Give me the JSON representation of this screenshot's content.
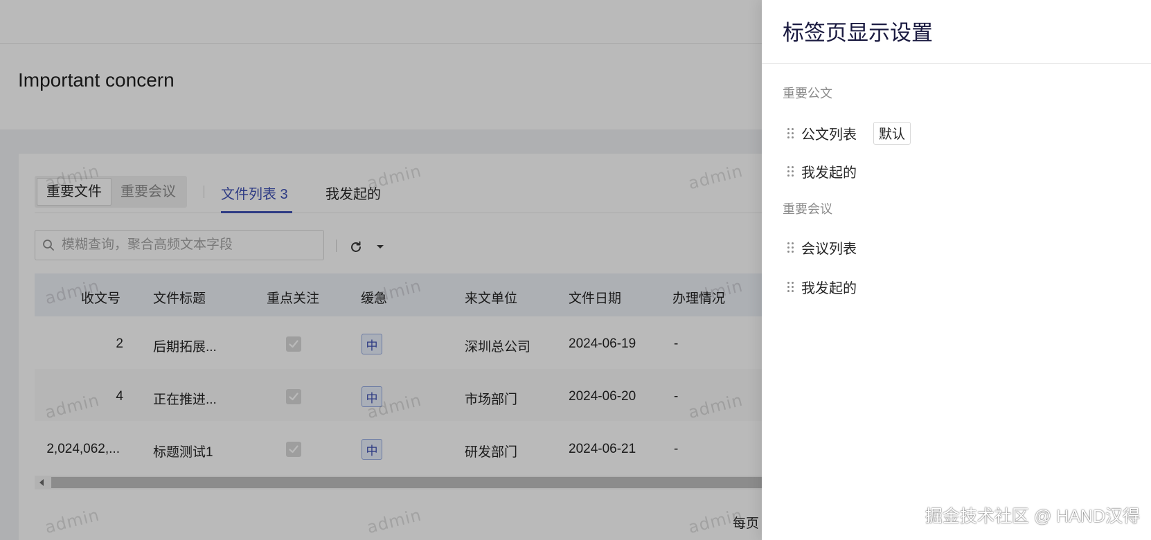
{
  "page": {
    "title": "Important concern"
  },
  "segmented": [
    {
      "label": "重要文件",
      "active": true
    },
    {
      "label": "重要会议",
      "active": false
    }
  ],
  "tabs": [
    {
      "label": "文件列表 3",
      "active": true
    },
    {
      "label": "我发起的",
      "active": false
    }
  ],
  "toolbar": {
    "search_placeholder": "模糊查询，聚合高频文本字段"
  },
  "table": {
    "columns": [
      "收文号",
      "文件标题",
      "重点关注",
      "缓急",
      "来文单位",
      "文件日期",
      "办理情况"
    ],
    "rows": [
      {
        "no": "2",
        "title": "后期拓展...",
        "focus": true,
        "urgency": "中",
        "unit": "深圳总公司",
        "date": "2024-06-19",
        "status": "-"
      },
      {
        "no": "4",
        "title": "正在推进...",
        "focus": true,
        "urgency": "中",
        "unit": "市场部门",
        "date": "2024-06-20",
        "status": "-"
      },
      {
        "no": "2,024,062,...",
        "title": "标题测试1",
        "focus": true,
        "urgency": "中",
        "unit": "研发部门",
        "date": "2024-06-21",
        "status": "-"
      }
    ]
  },
  "pagination": {
    "per_page_label": "每页"
  },
  "watermark": {
    "text": "admin"
  },
  "drawer": {
    "title": "标签页显示设置",
    "groups": [
      {
        "title": "重要公文",
        "items": [
          {
            "label": "公文列表",
            "badge": "默认"
          },
          {
            "label": "我发起的"
          }
        ]
      },
      {
        "title": "重要会议",
        "items": [
          {
            "label": "会议列表"
          },
          {
            "label": "我发起的"
          }
        ]
      }
    ]
  },
  "footer_watermark": "掘金技术社区 @ HAND汉得",
  "colors": {
    "accent": "#3f51b5",
    "mask": "rgba(0,0,0,0.27)",
    "tag_border": "#91a7e0"
  },
  "icons": [
    "search-icon",
    "refresh-icon",
    "caret-down-icon",
    "check-icon",
    "drag-handle-icon",
    "scroll-left-icon"
  ]
}
